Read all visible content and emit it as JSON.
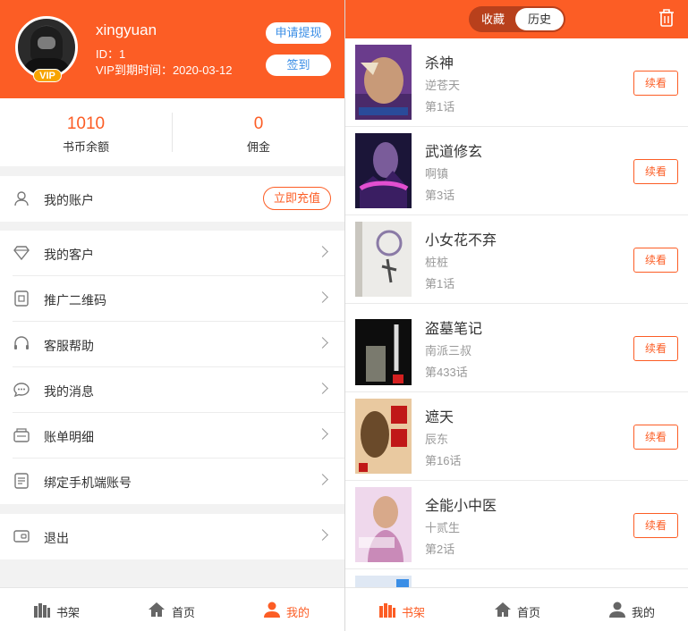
{
  "colors": {
    "accent": "#fc5d25",
    "link": "#3a8ee6",
    "vip": "#f7a400",
    "muted": "#999999"
  },
  "profile": {
    "username": "xingyuan",
    "id_text": "ID：1",
    "vip_badge": "VIP",
    "vip_expiry": "VIP到期时间：2020-03-12",
    "withdraw_label": "申请提现",
    "signin_label": "签到"
  },
  "balance": {
    "coins_value": "1010",
    "coins_label": "书币余额",
    "commission_value": "0",
    "commission_label": "佣金"
  },
  "account": {
    "label": "我的账户",
    "recharge_label": "立即充值",
    "icon": "user-icon"
  },
  "menu": [
    {
      "label": "我的客户",
      "icon": "diamond-icon"
    },
    {
      "label": "推广二维码",
      "icon": "qr-card-icon"
    },
    {
      "label": "客服帮助",
      "icon": "headset-icon"
    },
    {
      "label": "我的消息",
      "icon": "chat-bubble-icon"
    },
    {
      "label": "账单明细",
      "icon": "bill-icon"
    },
    {
      "label": "绑定手机端账号",
      "icon": "phone-bind-icon"
    }
  ],
  "logout": {
    "label": "退出",
    "icon": "exit-icon"
  },
  "left_tabs": [
    {
      "label": "书架",
      "icon": "bookshelf-icon",
      "active": false
    },
    {
      "label": "首页",
      "icon": "home-icon",
      "active": false
    },
    {
      "label": "我的",
      "icon": "person-icon",
      "active": true
    }
  ],
  "right": {
    "seg_collect": "收藏",
    "seg_history": "历史",
    "continue_label": "续看",
    "books": [
      {
        "title": "杀神",
        "author": "逆苍天",
        "chapter": "第1话"
      },
      {
        "title": "武道修玄",
        "author": "啊镇",
        "chapter": "第3话"
      },
      {
        "title": "小女花不弃",
        "author": "桩桩",
        "chapter": "第1话"
      },
      {
        "title": "盗墓笔记",
        "author": "南派三叔",
        "chapter": "第433话"
      },
      {
        "title": "遮天",
        "author": "辰东",
        "chapter": "第16话"
      },
      {
        "title": "全能小中医",
        "author": "十贰生",
        "chapter": "第2话"
      }
    ]
  },
  "right_tabs": [
    {
      "label": "书架",
      "icon": "bookshelf-icon",
      "active": true
    },
    {
      "label": "首页",
      "icon": "home-icon",
      "active": false
    },
    {
      "label": "我的",
      "icon": "person-icon",
      "active": false
    }
  ]
}
